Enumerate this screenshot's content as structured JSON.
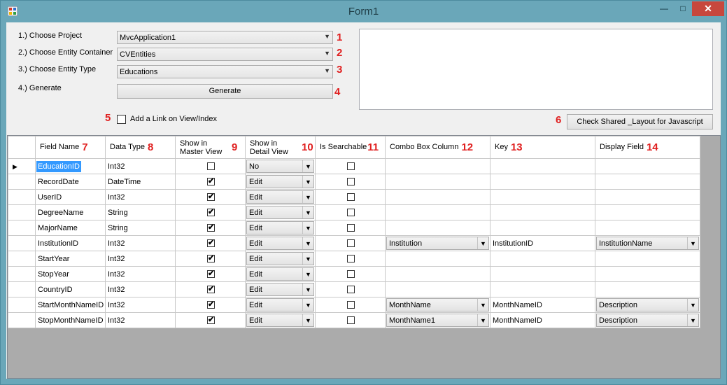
{
  "window": {
    "title": "Form1"
  },
  "controls": {
    "project": {
      "label": "1.) Choose Project",
      "value": "MvcApplication1",
      "badge": "1"
    },
    "container": {
      "label": "2.) Choose Entity Container",
      "value": "CVEntities",
      "badge": "2"
    },
    "entity": {
      "label": "3.) Choose Entity  Type",
      "value": "Educations",
      "badge": "3"
    },
    "generate": {
      "label": "4.) Generate",
      "button": "Generate",
      "badge": "4"
    },
    "link": {
      "label": "Add a Link on View/Index",
      "badge": "5",
      "checked": false
    },
    "layout": {
      "button": "Check Shared _Layout for Javascript",
      "badge": "6"
    }
  },
  "grid": {
    "columns": [
      {
        "label": "Field Name",
        "badge": "7"
      },
      {
        "label": "Data Type",
        "badge": "8"
      },
      {
        "label": "Show in Master View",
        "badge": "9"
      },
      {
        "label": "Show in Detail View",
        "badge": "10"
      },
      {
        "label": "Is Searchable",
        "badge": "11"
      },
      {
        "label": "Combo Box Column",
        "badge": "12"
      },
      {
        "label": "Key",
        "badge": "13"
      },
      {
        "label": "Display Field",
        "badge": "14"
      }
    ],
    "rows": [
      {
        "field": "EducationID",
        "type": "Int32",
        "master": false,
        "detail": "No",
        "searchable": false,
        "combo": "",
        "key": "",
        "display": ""
      },
      {
        "field": "RecordDate",
        "type": "DateTime",
        "master": true,
        "detail": "Edit",
        "searchable": false,
        "combo": "",
        "key": "",
        "display": ""
      },
      {
        "field": "UserID",
        "type": "Int32",
        "master": true,
        "detail": "Edit",
        "searchable": false,
        "combo": "",
        "key": "",
        "display": ""
      },
      {
        "field": "DegreeName",
        "type": "String",
        "master": true,
        "detail": "Edit",
        "searchable": false,
        "combo": "",
        "key": "",
        "display": ""
      },
      {
        "field": "MajorName",
        "type": "String",
        "master": true,
        "detail": "Edit",
        "searchable": false,
        "combo": "",
        "key": "",
        "display": ""
      },
      {
        "field": "InstitutionID",
        "type": "Int32",
        "master": true,
        "detail": "Edit",
        "searchable": false,
        "combo": "Institution",
        "key": "InstitutionID",
        "display": "InstitutionName"
      },
      {
        "field": "StartYear",
        "type": "Int32",
        "master": true,
        "detail": "Edit",
        "searchable": false,
        "combo": "",
        "key": "",
        "display": ""
      },
      {
        "field": "StopYear",
        "type": "Int32",
        "master": true,
        "detail": "Edit",
        "searchable": false,
        "combo": "",
        "key": "",
        "display": ""
      },
      {
        "field": "CountryID",
        "type": "Int32",
        "master": true,
        "detail": "Edit",
        "searchable": false,
        "combo": "",
        "key": "",
        "display": ""
      },
      {
        "field": "StartMonthNameID",
        "type": "Int32",
        "master": true,
        "detail": "Edit",
        "searchable": false,
        "combo": "MonthName",
        "key": "MonthNameID",
        "display": "Description"
      },
      {
        "field": "StopMonthNameID",
        "type": "Int32",
        "master": true,
        "detail": "Edit",
        "searchable": false,
        "combo": "MonthName1",
        "key": "MonthNameID",
        "display": "Description"
      }
    ]
  }
}
